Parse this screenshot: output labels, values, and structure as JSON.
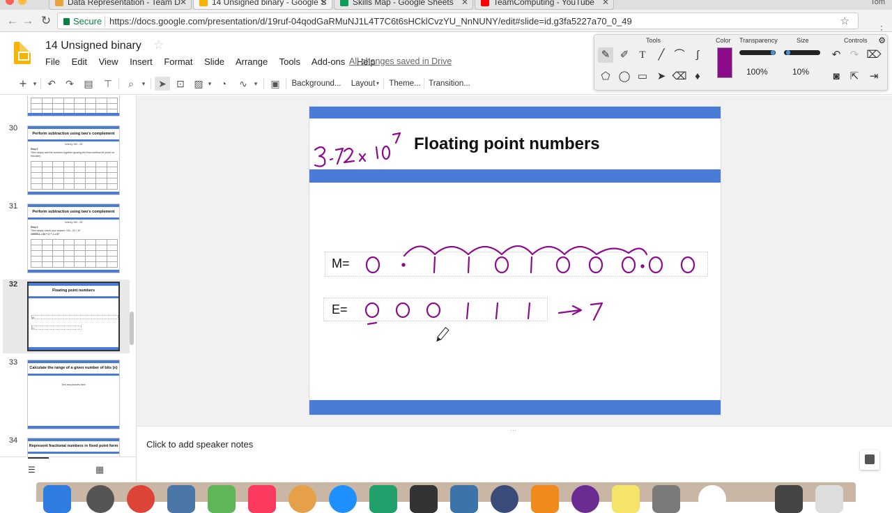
{
  "browser": {
    "tabs": [
      {
        "title": "Data Representation - Team D",
        "color": "#e8a33d"
      },
      {
        "title": "14 Unsigned binary - Google S",
        "color": "#f4b400",
        "active": true
      },
      {
        "title": "Skills Map - Google Sheets",
        "color": "#0f9d58"
      },
      {
        "title": "TeamComputing - YouTube",
        "color": "#ff0000"
      }
    ],
    "profile": "Tom",
    "secure_label": "Secure",
    "url": "https://docs.google.com/presentation/d/19ruf-04qodGaRMuNJ1L4T7C6t6sHCklCvzYU_NnNUNY/edit#slide=id.g3fa5227a70_0_49"
  },
  "doc": {
    "title": "14 Unsigned binary",
    "menus": [
      "File",
      "Edit",
      "View",
      "Insert",
      "Format",
      "Slide",
      "Arrange",
      "Tools",
      "Add-ons",
      "Help"
    ],
    "save_status": "All changes saved in Drive"
  },
  "toolbar": {
    "background": "Background...",
    "layout": "Layout",
    "theme": "Theme...",
    "transition": "Transition..."
  },
  "filmstrip": [
    {
      "number": "30",
      "title": "Perform subtraction using two's complement",
      "sub": "Lets try 100 - 33",
      "step": "Step 3",
      "text": "Then simply add the numbers together ignoring the final overflow bit (more on this later)"
    },
    {
      "number": "31",
      "title": "Perform subtraction using two's complement",
      "sub": "Lets try 100 - 33",
      "step": "Step 4",
      "text": "Then simply check your answer: 100 - 33 = 67",
      "text2": "1000011 = 64 + 2 + 1 = 67"
    },
    {
      "number": "32",
      "title": "Floating point numbers",
      "m": "M=",
      "e": "E="
    },
    {
      "number": "33",
      "title": "Calculate the range of a given number of bits (n)",
      "text": "Text and pictures here"
    },
    {
      "number": "34",
      "title": "Represent fractional numbers in fixed point form"
    }
  ],
  "table_headers": [
    "-128",
    "64",
    "32",
    "16",
    "8",
    "4",
    "2",
    "1"
  ],
  "slide": {
    "title": "Floating point numbers",
    "m_label": "M=",
    "e_label": "E=",
    "mantissa_digits": [
      "0",
      ".",
      "1",
      "1",
      "0",
      "1",
      "0",
      "0",
      "0",
      ".",
      "0",
      "0"
    ],
    "exponent_digits": [
      "0",
      "0",
      "0",
      "1",
      "1",
      "1"
    ],
    "exponent_result": "7",
    "ink_color": "#8b0b8b",
    "bar_color": "#4a7bd6"
  },
  "notes": {
    "placeholder": "Click to add speaker notes"
  },
  "palette": {
    "tools_label": "Tools",
    "color_label": "Color",
    "transparency_label": "Transparency",
    "size_label": "Size",
    "controls_label": "Controls",
    "transparency_value": "100%",
    "size_value": "10%",
    "color": "#8b0b8b"
  }
}
